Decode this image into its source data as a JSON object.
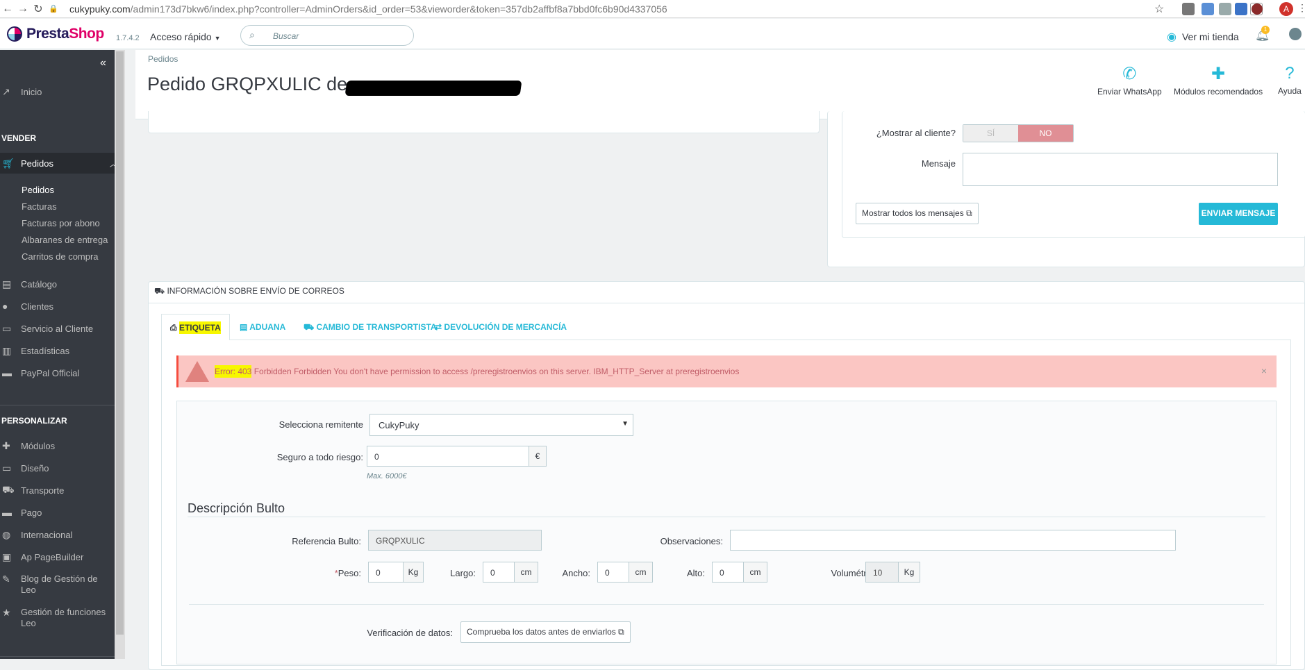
{
  "browser": {
    "url_host": "cukypuky.com",
    "url_path": "/admin173d7bkw6/index.php?controller=AdminOrders&id_order=53&vieworder&token=357db2affbf8a7bbd0fc6b90d4337056",
    "profile_initial": "A"
  },
  "header": {
    "brand_presta": "Presta",
    "brand_shop": "Shop",
    "version": "1.7.4.2",
    "quick_access": "Acceso rápido",
    "search_placeholder": "Buscar",
    "view_shop": "Ver mi tienda",
    "notification_count": "1"
  },
  "sidebar": {
    "home": "Inicio",
    "section_sell": "VENDER",
    "orders": "Pedidos",
    "orders_sub": [
      "Pedidos",
      "Facturas",
      "Facturas por abono",
      "Albaranes de entrega",
      "Carritos de compra"
    ],
    "catalog": "Catálogo",
    "customers": "Clientes",
    "customer_service": "Servicio al Cliente",
    "stats": "Estadísticas",
    "paypal": "PayPal Official",
    "section_customize": "PERSONALIZAR",
    "modules": "Módulos",
    "design": "Diseño",
    "shipping": "Transporte",
    "payment": "Pago",
    "international": "Internacional",
    "pagebuilder": "Ap PageBuilder",
    "blog_1": "Blog de Gestión de",
    "blog_2": "Leo",
    "functions_1": "Gestión de funciones",
    "functions_2": "Leo"
  },
  "page": {
    "breadcrumb": "Pedidos",
    "title": "Pedido GRQPXULIC de",
    "toolbar": {
      "whatsapp": "Enviar WhatsApp",
      "modules": "Módulos recomendados",
      "help": "Ayuda"
    }
  },
  "messages": {
    "show_customer_label": "¿Mostrar al cliente?",
    "yes": "SÍ",
    "no": "NO",
    "message_label": "Mensaje",
    "show_all": "Mostrar todos los mensajes",
    "send": "ENVIAR MENSAJE"
  },
  "correos": {
    "panel_title": "INFORMACIÓN SOBRE ENVÍO DE CORREOS",
    "tabs": [
      "ETIQUETA",
      "ADUANA",
      "CAMBIO DE TRANSPORTISTA",
      "DEVOLUCIÓN DE MERCANCÍA"
    ],
    "error_code": "Error: 403",
    "error_text": " Forbidden Forbidden You don't have permission to access /preregistroenvios on this server. IBM_HTTP_Server at preregistroenvios",
    "sender_label": "Selecciona remitente",
    "sender_value": "CukyPuky",
    "insurance_label": "Seguro a todo riesgo:",
    "insurance_value": "0",
    "currency": "€",
    "insurance_hint": "Max. 6000€",
    "package_heading": "Descripción Bulto",
    "ref_label": "Referencia Bulto:",
    "ref_value": "GRQPXULIC",
    "obs_label": "Observaciones:",
    "obs_value": "",
    "weight_req": "*",
    "weight_label": "Peso:",
    "weight_value": "0",
    "weight_unit": "Kg",
    "length_label": "Largo:",
    "length_value": "0",
    "width_label": "Ancho:",
    "width_value": "0",
    "height_label": "Alto:",
    "height_value": "0",
    "cm": "cm",
    "volumetric_label": "Volumétrico:",
    "volumetric_value": "10",
    "verify_label": "Verificación de datos:",
    "verify_button": "Comprueba los datos antes de enviarlos"
  }
}
